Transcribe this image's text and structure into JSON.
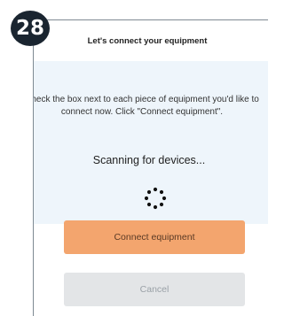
{
  "step": {
    "number": "28"
  },
  "dialog": {
    "title": "Let's connect your equipment",
    "instructions": "Check the box next to each piece of equipment you'd like to connect now. Click \"Connect equipment\".",
    "status": "Scanning for devices...",
    "primary_button": "Connect equipment",
    "secondary_button": "Cancel"
  },
  "icons": {
    "spinner": "loading-spinner-icon"
  },
  "colors": {
    "badge": "#1a2530",
    "body_background": "#eef5fb",
    "primary_button": "#f3a56e",
    "secondary_button": "#e3e5e7"
  }
}
